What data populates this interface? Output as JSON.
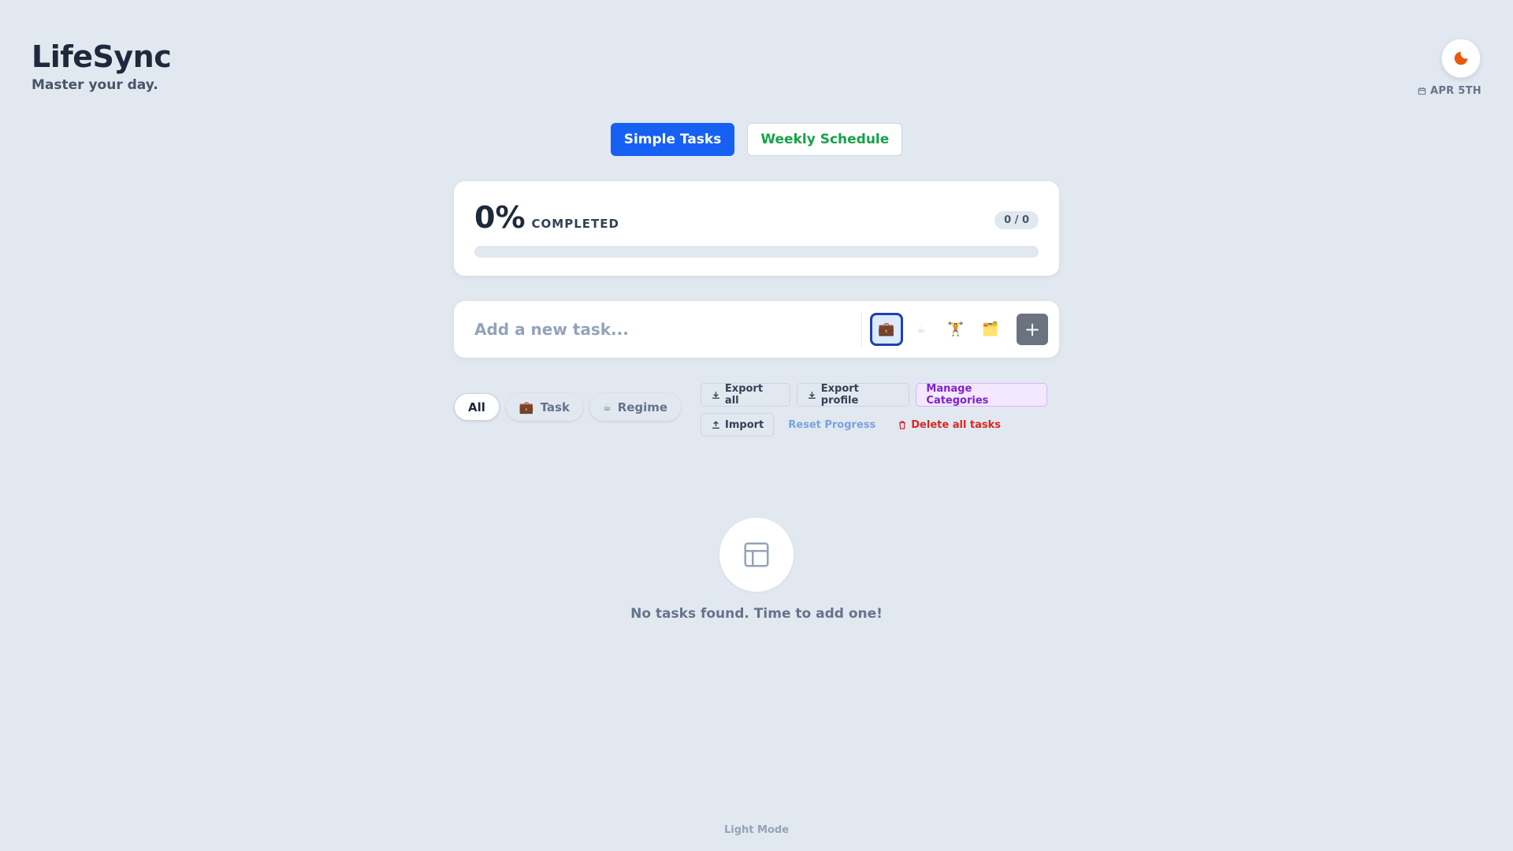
{
  "app": {
    "title": "LifeSync",
    "tagline": "Master your day."
  },
  "header": {
    "date": "APR 5TH",
    "theme_icon": "moon-icon",
    "calendar_icon": "calendar-icon"
  },
  "mode_tabs": [
    {
      "label": "Simple Tasks",
      "active": true
    },
    {
      "label": "Weekly Schedule",
      "active": false
    }
  ],
  "progress": {
    "percent_label": "0%",
    "completed_label": "COMPLETED",
    "count_label": "0 / 0",
    "fraction": 0
  },
  "task_input": {
    "placeholder": "Add a new task...",
    "value": "",
    "categories": [
      {
        "icon": "💼",
        "name": "briefcase-icon",
        "selected": true
      },
      {
        "icon": "☕",
        "name": "coffee-icon",
        "selected": false
      },
      {
        "icon": "🏋",
        "name": "weightlifting-icon",
        "selected": false
      },
      {
        "icon": "🗂️",
        "name": "card-index-icon",
        "selected": false
      }
    ],
    "add_label": "+"
  },
  "filters": [
    {
      "label": "All",
      "icon": "",
      "active": true
    },
    {
      "label": "Task",
      "icon": "💼",
      "active": false
    },
    {
      "label": "Regime",
      "icon": "☕",
      "active": false
    }
  ],
  "actions": {
    "export_all": "Export all",
    "export_profile": "Export profile",
    "manage_categories": "Manage Categories",
    "import": "Import",
    "reset_progress": "Reset Progress",
    "delete_all": "Delete all tasks"
  },
  "empty_state": {
    "message": "No tasks found. Time to add one!",
    "icon": "layout-icon"
  },
  "footer": {
    "mode_label": "Light Mode"
  },
  "colors": {
    "accent": "#1661f4",
    "success": "#16a34a",
    "danger": "#dc2626",
    "purple": "#7e22ce",
    "theme_icon": "#ea580c"
  }
}
